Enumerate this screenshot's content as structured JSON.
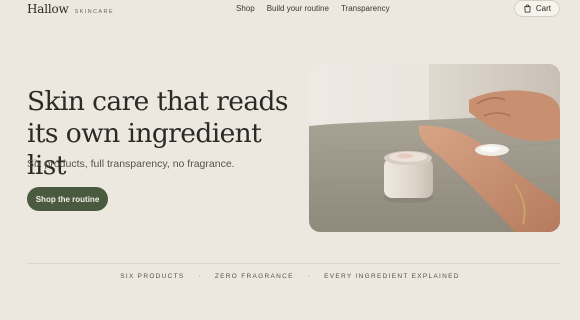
{
  "brand": {
    "name": "Hallow",
    "tagline": "SKINCARE"
  },
  "nav": {
    "items": [
      {
        "label": "Shop"
      },
      {
        "label": "Build your routine"
      },
      {
        "label": "Transparency"
      }
    ]
  },
  "cart": {
    "label": "Cart",
    "icon": "shopping-bag-icon"
  },
  "hero": {
    "title": "Skin care that reads its own ingredient list",
    "subtitle": "Six products, full transparency, no fragrance.",
    "cta_label": "Shop the routine",
    "image_alt": "hand applying cream from a jar"
  },
  "features": {
    "items": [
      "SIX PRODUCTS",
      "ZERO FRAGRANCE",
      "EVERY INGREDIENT EXPLAINED"
    ],
    "separator": "·"
  },
  "colors": {
    "background": "#ede8df",
    "accent": "#4a5a3f",
    "text": "#2b2a26"
  }
}
